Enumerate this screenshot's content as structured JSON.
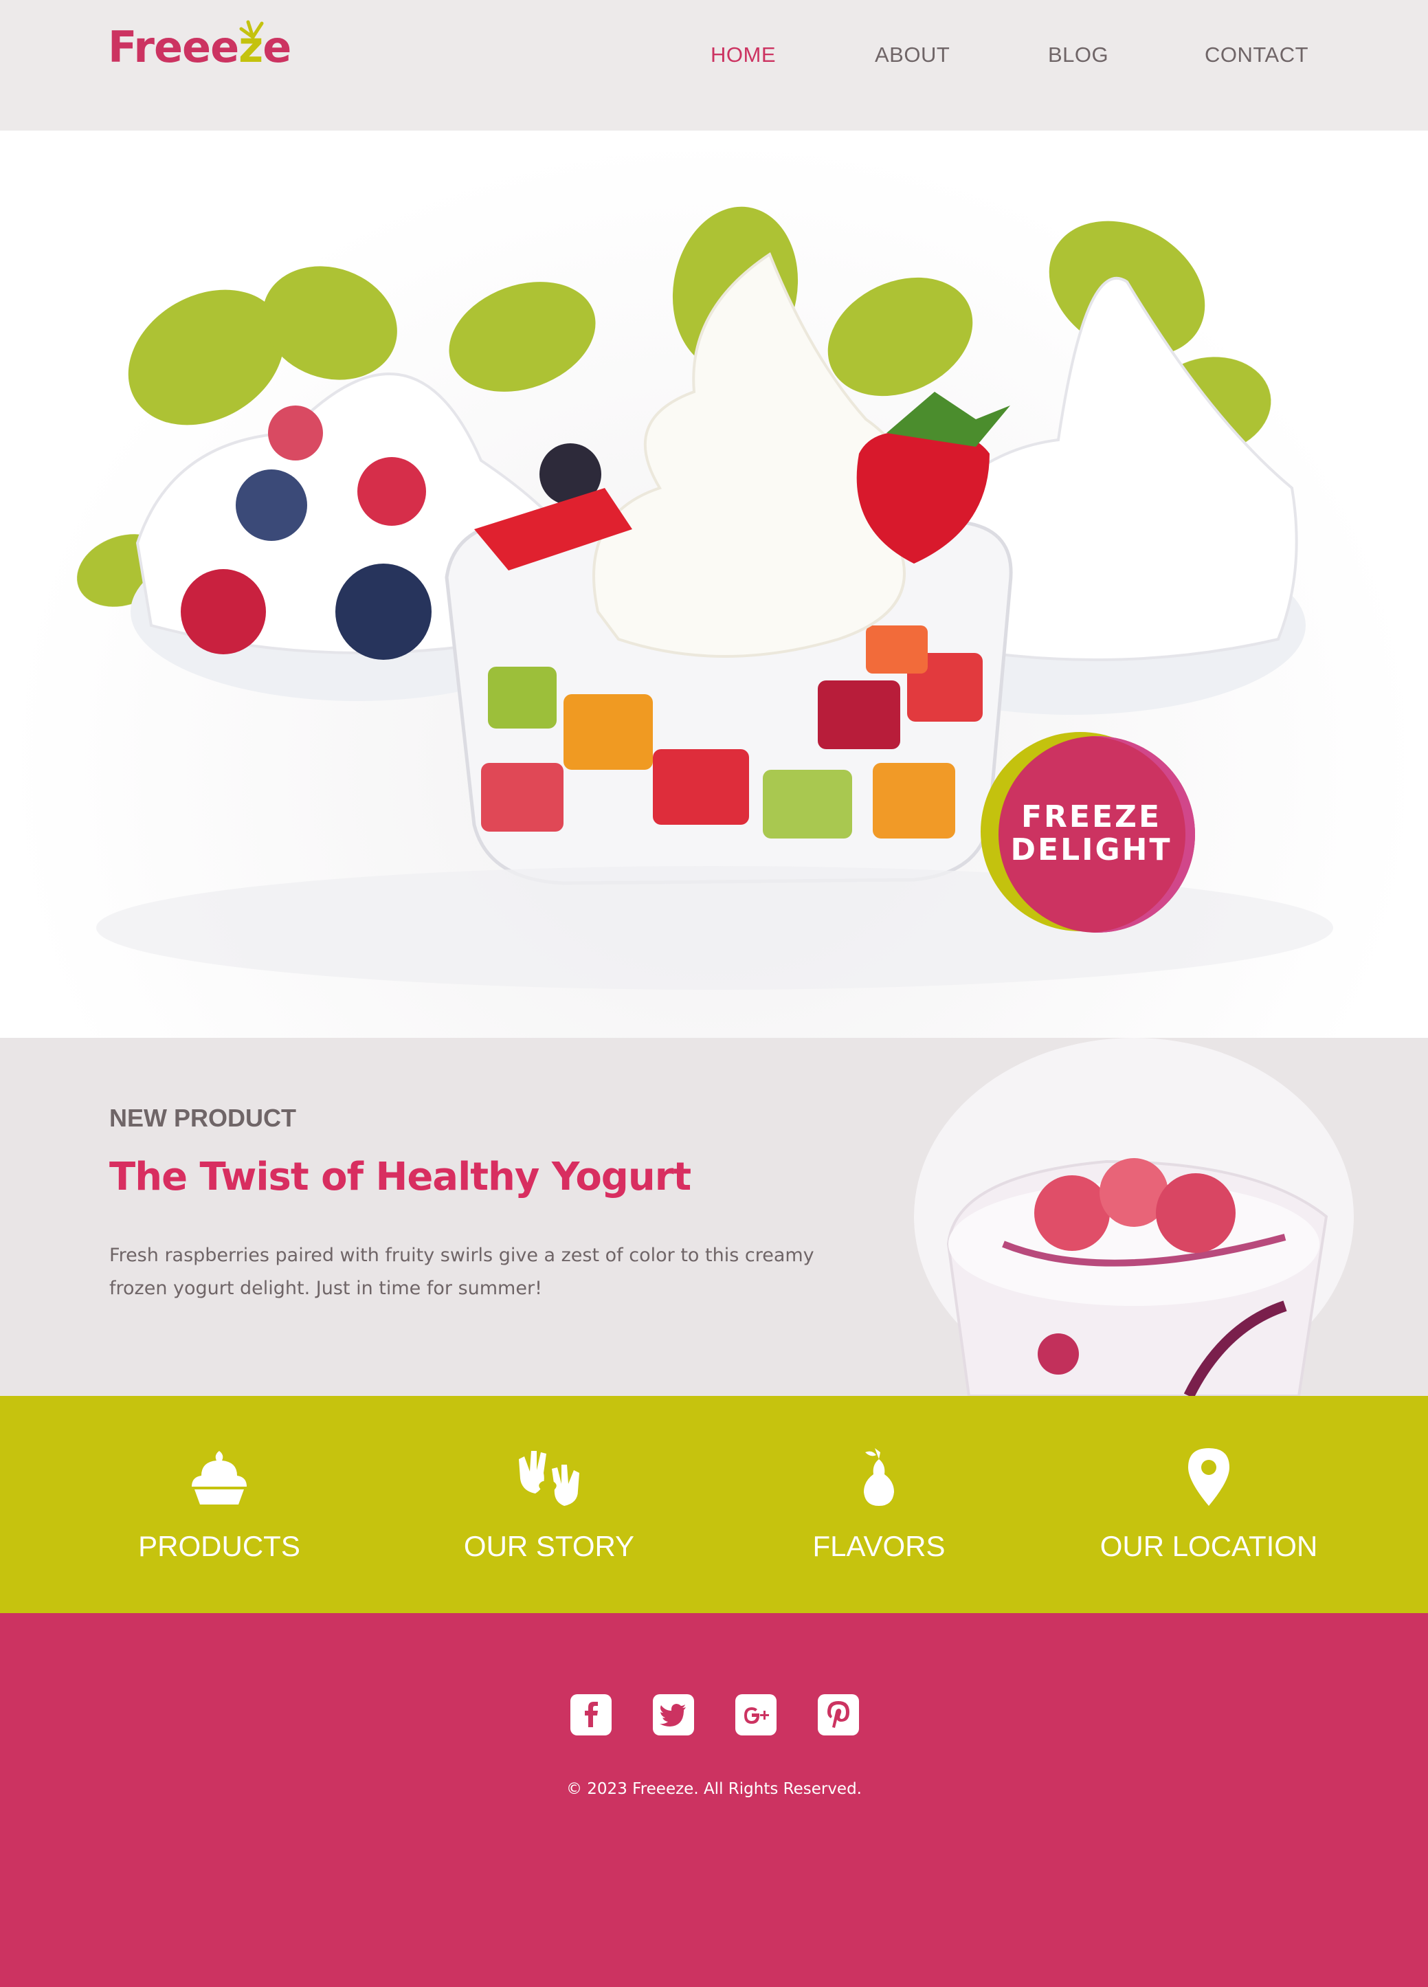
{
  "brand": {
    "name": "Freeeze",
    "primary_color": "#cc3361",
    "accent_color": "#c4c20e"
  },
  "nav": {
    "items": [
      {
        "label": "HOME",
        "active": true
      },
      {
        "label": "ABOUT",
        "active": false
      },
      {
        "label": "BLOG",
        "active": false
      },
      {
        "label": "CONTACT",
        "active": false
      }
    ]
  },
  "hero": {
    "image": "frozen-yogurt-bowls-with-fruit-illustration",
    "badge_line1": "FREEZE",
    "badge_line2": "DELIGHT"
  },
  "new_product": {
    "eyebrow": "NEW PRODUCT",
    "title": "The Twist of Healthy Yogurt",
    "description": "Fresh raspberries paired with fruity swirls give a zest of color to this creamy frozen yogurt delight. Just in time for summer!",
    "image": "raspberry-yogurt-cup-illustration"
  },
  "features": [
    {
      "label": "PRODUCTS",
      "icon": "cupcake-icon"
    },
    {
      "label": "OUR STORY",
      "icon": "hands-heart-icon"
    },
    {
      "label": "FLAVORS",
      "icon": "pear-icon"
    },
    {
      "label": "OUR LOCATION",
      "icon": "map-pin-icon"
    }
  ],
  "footer": {
    "social": [
      {
        "name": "facebook-icon",
        "glyph": "f"
      },
      {
        "name": "twitter-icon",
        "glyph": "t"
      },
      {
        "name": "google-plus-icon",
        "glyph": "g+"
      },
      {
        "name": "pinterest-icon",
        "glyph": "p"
      }
    ],
    "copyright": "© 2023 Freeeze. All Rights Reserved."
  }
}
